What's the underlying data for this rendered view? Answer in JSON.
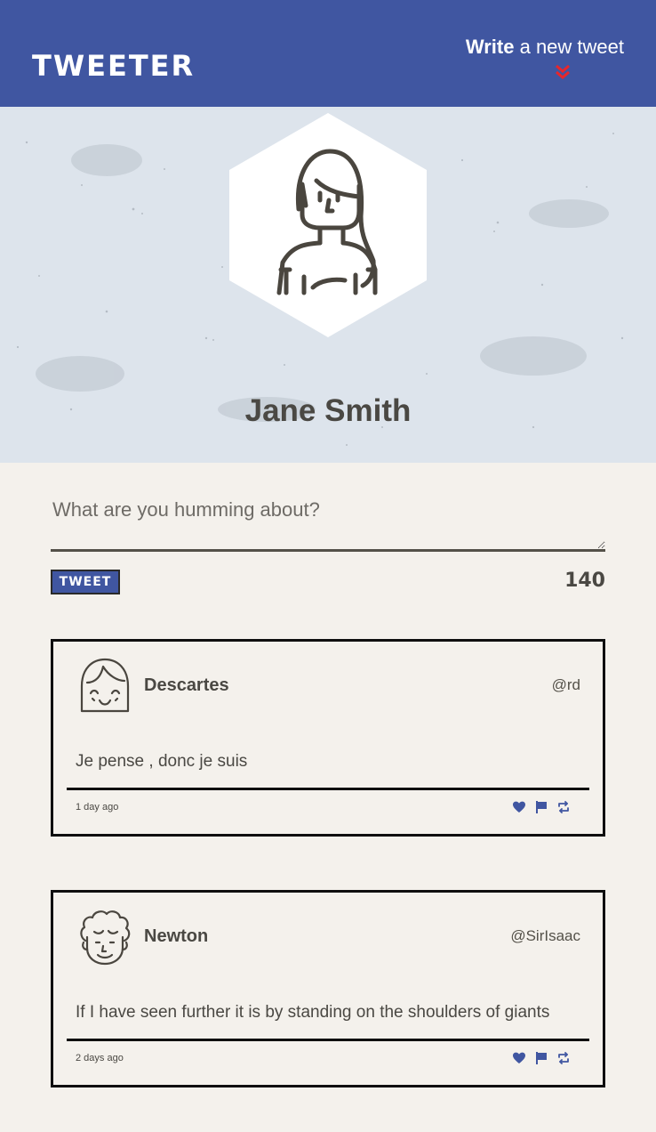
{
  "nav": {
    "brand": "TWEETER",
    "compose_strong": "Write",
    "compose_rest": " a new tweet",
    "icon": "double-chevron-down-icon"
  },
  "profile": {
    "name": "Jane Smith",
    "avatar_icon": "woman-avatar-icon"
  },
  "composer": {
    "placeholder": "What are you humming about?",
    "value": "",
    "button_label": "TWEET",
    "char_count": "140"
  },
  "tweets": [
    {
      "name": "Descartes",
      "handle": "@rd",
      "text": "Je pense , donc je suis",
      "time": "1 day ago",
      "avatar_icon": "smiling-girl-avatar-icon"
    },
    {
      "name": "Newton",
      "handle": "@SirIsaac",
      "text": "If I have seen further it is by standing on the shoulders of giants",
      "time": "2 days ago",
      "avatar_icon": "curly-hair-man-avatar-icon"
    }
  ],
  "actions": [
    "heart-icon",
    "flag-icon",
    "retweet-icon"
  ],
  "colors": {
    "nav": "#4056a1",
    "background": "#f4f1ec",
    "text": "#4a4843",
    "accent_red": "#e8262b",
    "profile_bg": "#dde4ec"
  }
}
